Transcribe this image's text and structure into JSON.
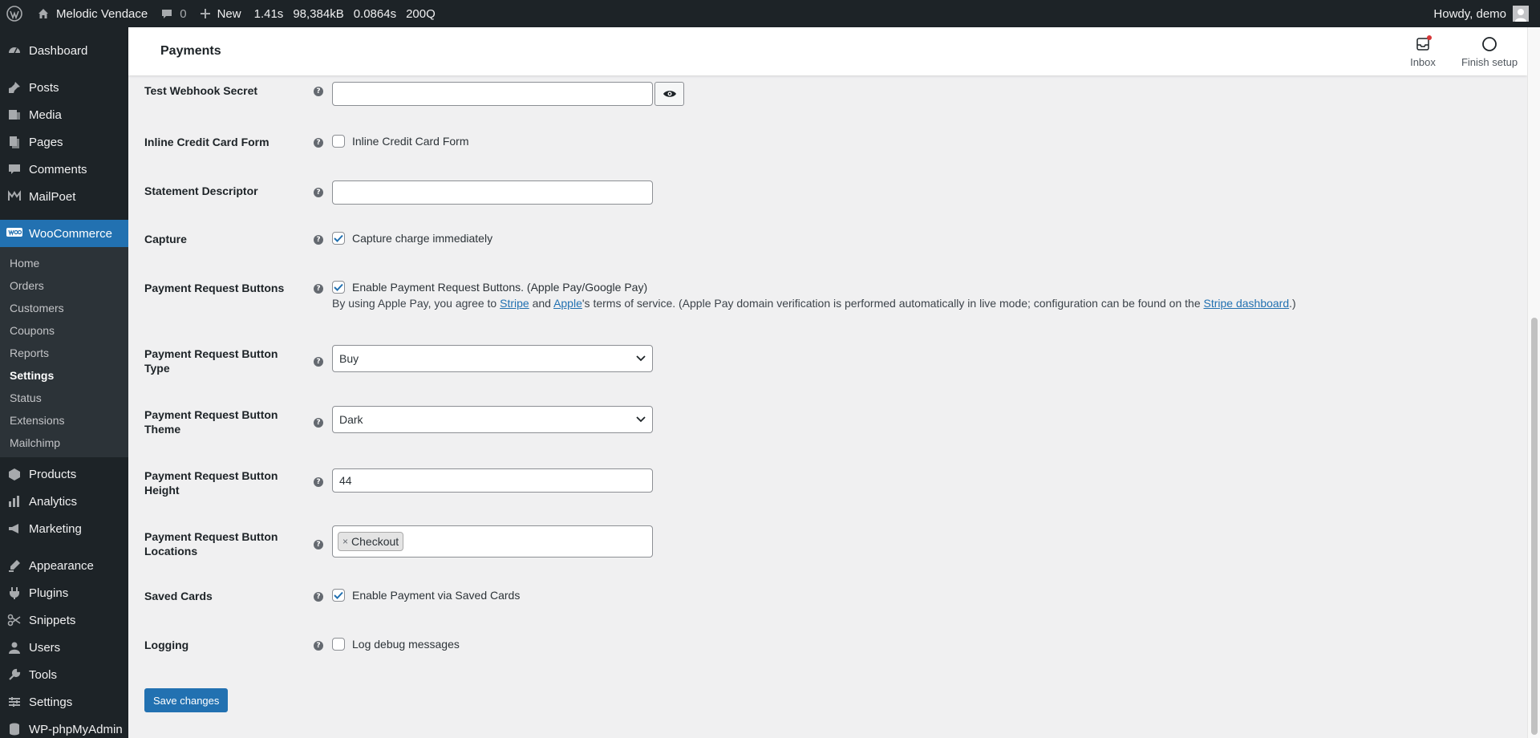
{
  "adminbar": {
    "site_name": "Melodic Vendace",
    "comments_count": "0",
    "new_label": "New",
    "stats": [
      "1.41s",
      "98,384kB",
      "0.0864s",
      "200Q"
    ],
    "howdy": "Howdy, demo"
  },
  "sidebar": {
    "items_top": [
      {
        "label": "Dashboard",
        "icon": "dashboard-icon"
      },
      {
        "label": "Posts",
        "icon": "pin-icon"
      },
      {
        "label": "Media",
        "icon": "media-icon"
      },
      {
        "label": "Pages",
        "icon": "pages-icon"
      },
      {
        "label": "Comments",
        "icon": "comments-icon"
      },
      {
        "label": "MailPoet",
        "icon": "mailpoet-icon"
      }
    ],
    "active": {
      "label": "WooCommerce",
      "icon": "woo-icon"
    },
    "submenu": [
      "Home",
      "Orders",
      "Customers",
      "Coupons",
      "Reports",
      "Settings",
      "Status",
      "Extensions",
      "Mailchimp"
    ],
    "submenu_current": "Settings",
    "items_bottom": [
      {
        "label": "Products",
        "icon": "products-icon"
      },
      {
        "label": "Analytics",
        "icon": "analytics-icon"
      },
      {
        "label": "Marketing",
        "icon": "marketing-icon"
      },
      {
        "label": "Appearance",
        "icon": "appearance-icon"
      },
      {
        "label": "Plugins",
        "icon": "plugins-icon"
      },
      {
        "label": "Snippets",
        "icon": "snippets-icon"
      },
      {
        "label": "Users",
        "icon": "users-icon"
      },
      {
        "label": "Tools",
        "icon": "tools-icon"
      },
      {
        "label": "Settings",
        "icon": "settings-icon"
      },
      {
        "label": "WP-phpMyAdmin",
        "icon": "database-icon"
      }
    ]
  },
  "header": {
    "title": "Payments",
    "inbox_label": "Inbox",
    "finish_setup_label": "Finish setup"
  },
  "form": {
    "webhook": {
      "label": "Test Webhook Secret",
      "value": ""
    },
    "inline_cc": {
      "label": "Inline Credit Card Form",
      "checkbox_label": "Inline Credit Card Form",
      "checked": false
    },
    "statement": {
      "label": "Statement Descriptor",
      "value": ""
    },
    "capture": {
      "label": "Capture",
      "checkbox_label": "Capture charge immediately",
      "checked": true
    },
    "prb": {
      "label": "Payment Request Buttons",
      "checkbox_label": "Enable Payment Request Buttons. (Apple Pay/Google Pay)",
      "checked": true,
      "desc_1": "By using Apple Pay, you agree to ",
      "link_stripe": "Stripe",
      "desc_2": " and ",
      "link_apple": "Apple",
      "desc_3": "'s terms of service. (Apple Pay domain verification is performed automatically in live mode; configuration can be found on the ",
      "link_dashboard": "Stripe dashboard",
      "desc_4": ".)"
    },
    "prb_type": {
      "label": "Payment Request Button Type",
      "value": "Buy"
    },
    "prb_theme": {
      "label": "Payment Request Button Theme",
      "value": "Dark"
    },
    "prb_height": {
      "label": "Payment Request Button Height",
      "value": "44"
    },
    "prb_locations": {
      "label": "Payment Request Button Locations",
      "chip": "Checkout",
      "chip_remove": "×"
    },
    "saved_cards": {
      "label": "Saved Cards",
      "checkbox_label": "Enable Payment via Saved Cards",
      "checked": true
    },
    "logging": {
      "label": "Logging",
      "checkbox_label": "Log debug messages",
      "checked": false
    },
    "help_glyph": "?",
    "save_label": "Save changes"
  },
  "colors": {
    "accent": "#2271b1",
    "admin_dark": "#1d2327"
  }
}
